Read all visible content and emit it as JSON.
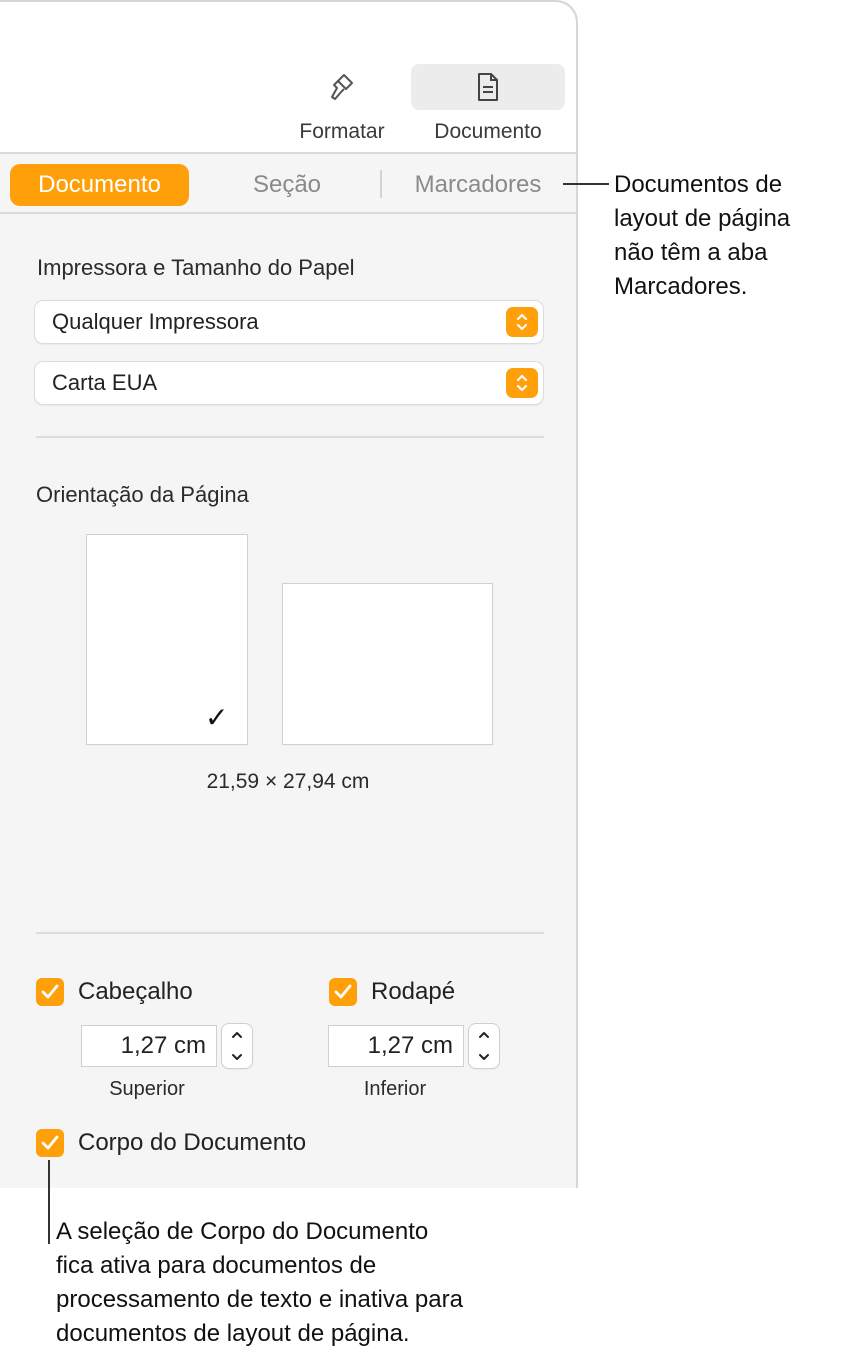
{
  "toolbar": {
    "format_label": "Formatar",
    "document_label": "Documento",
    "format_icon": "paintbrush-icon",
    "document_icon": "document-icon"
  },
  "tabs": [
    {
      "label": "Documento",
      "selected": true
    },
    {
      "label": "Seção",
      "selected": false
    },
    {
      "label": "Marcadores",
      "selected": false
    }
  ],
  "printer_section": {
    "title": "Impressora e Tamanho do Papel",
    "printer_value": "Qualquer Impressora",
    "paper_value": "Carta EUA"
  },
  "orientation": {
    "title": "Orientação da Página",
    "selected": "portrait",
    "check_glyph": "✓",
    "dimensions": "21,59 × 27,94 cm"
  },
  "header_footer": {
    "header_label": "Cabeçalho",
    "header_checked": true,
    "header_value": "1,27 cm",
    "header_caption": "Superior",
    "footer_label": "Rodapé",
    "footer_checked": true,
    "footer_value": "1,27 cm",
    "footer_caption": "Inferior",
    "body_label": "Corpo do Documento",
    "body_checked": true
  },
  "callouts": {
    "tab_note": [
      "Documentos de",
      "layout de página",
      "não têm a aba",
      "Marcadores."
    ],
    "body_note": [
      "A seleção de Corpo do Documento",
      "fica ativa para documentos de",
      "processamento de texto e inativa para",
      "documentos de layout de página."
    ]
  },
  "colors": {
    "accent": "#ff9f0a",
    "panel_bg": "#f5f5f5"
  }
}
